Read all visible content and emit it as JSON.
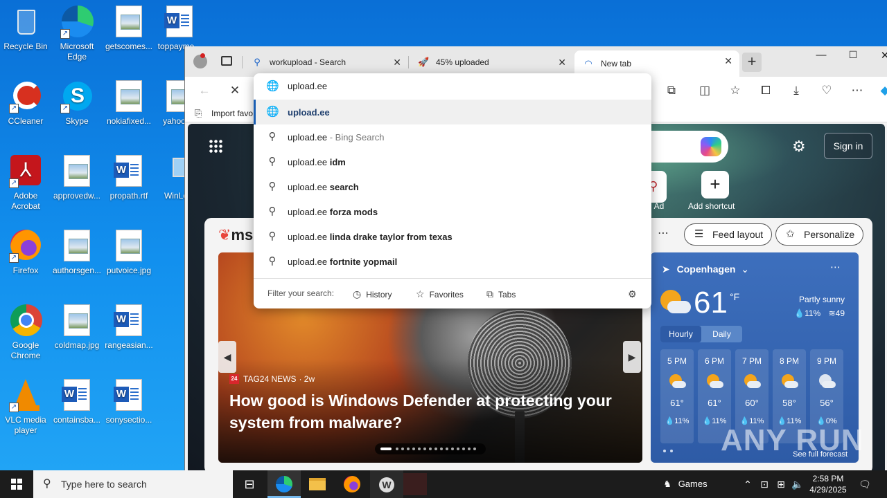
{
  "desktop": {
    "icons": [
      {
        "label": "Recycle Bin"
      },
      {
        "label": "Microsoft Edge"
      },
      {
        "label": "getscomes..."
      },
      {
        "label": "toppayme..."
      },
      {
        "label": "CCleaner"
      },
      {
        "label": "Skype"
      },
      {
        "label": "nokiafixed..."
      },
      {
        "label": "yahoov..."
      },
      {
        "label": "Adobe Acrobat"
      },
      {
        "label": "approvedw..."
      },
      {
        "label": "propath.rtf"
      },
      {
        "label": "WinLo..."
      },
      {
        "label": "Firefox"
      },
      {
        "label": "authorsgen..."
      },
      {
        "label": "putvoice.jpg"
      },
      {
        "label": "Google Chrome"
      },
      {
        "label": "coldmap.jpg"
      },
      {
        "label": "rangeasian..."
      },
      {
        "label": "VLC media player"
      },
      {
        "label": "containsba..."
      },
      {
        "label": "sonysectio..."
      }
    ]
  },
  "browser": {
    "tabs": [
      {
        "label": "workupload - Search"
      },
      {
        "label": "45% uploaded"
      },
      {
        "label": "New tab"
      }
    ],
    "favorites_bar": {
      "import_label": "Import favo"
    },
    "address": {
      "value": "upload.ee"
    },
    "suggestions": [
      {
        "prefix": "upload.ee",
        "suffix": "",
        "icon": "globe-icon"
      },
      {
        "prefix": "upload.ee",
        "suffix": " - Bing Search",
        "icon": "search-icon"
      },
      {
        "prefix": "upload.ee",
        "suffix": " idm",
        "icon": "search-icon"
      },
      {
        "prefix": "upload.ee",
        "suffix": " search",
        "icon": "search-icon"
      },
      {
        "prefix": "upload.ee",
        "suffix": " forza mods",
        "icon": "search-icon"
      },
      {
        "prefix": "upload.ee",
        "suffix": " linda drake taylor from texas",
        "icon": "search-icon"
      },
      {
        "prefix": "upload.ee",
        "suffix": " fortnite yopmail",
        "icon": "search-icon"
      }
    ],
    "filter": {
      "label": "Filter your search:",
      "history": "History",
      "favorites": "Favorites",
      "tabs": "Tabs"
    }
  },
  "newtab": {
    "signin": "Sign in",
    "quicklinks": {
      "ad_label": "C · Ad",
      "add_shortcut": "Add shortcut"
    },
    "msn_logo": "ms",
    "feed_layout": "Feed layout",
    "personalize": "Personalize",
    "hero": {
      "source": "TAG24 NEWS",
      "age": "· 2w",
      "headline": "How good is Windows Defender at protecting your system from malware?"
    },
    "weather": {
      "location": "Copenhagen",
      "temp": "61",
      "unit": "°F",
      "condition": "Partly sunny",
      "precip": "11%",
      "wind": "49",
      "tab_hourly": "Hourly",
      "tab_daily": "Daily",
      "hours": [
        {
          "time": "5 PM",
          "temp": "61°",
          "precip": "11%",
          "icon": "partly-sunny-icon"
        },
        {
          "time": "6 PM",
          "temp": "61°",
          "precip": "11%",
          "icon": "partly-sunny-icon"
        },
        {
          "time": "7 PM",
          "temp": "60°",
          "precip": "11%",
          "icon": "partly-sunny-icon"
        },
        {
          "time": "8 PM",
          "temp": "58°",
          "precip": "11%",
          "icon": "partly-sunny-icon"
        },
        {
          "time": "9 PM",
          "temp": "56°",
          "precip": "0%",
          "icon": "partly-cloudy-night-icon"
        }
      ],
      "see_full": "See full forecast"
    }
  },
  "taskbar": {
    "search_placeholder": "Type here to search",
    "games_label": "Games",
    "time": "2:58 PM",
    "date": "4/29/2025"
  },
  "watermark": "ANY RUN",
  "colors": {
    "desktop_blue": "#0f7fe6",
    "selection_accent": "#1a5fb4",
    "weather_card": "#2e5ba6"
  }
}
